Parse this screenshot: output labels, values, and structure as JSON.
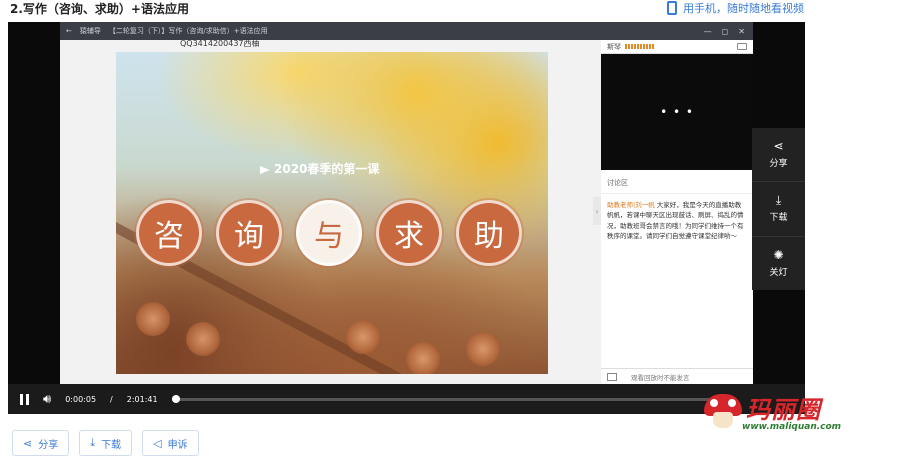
{
  "page": {
    "title": "2.写作（咨询、求助）+语法应用",
    "mobile_link": "用手机，随时随地看视频"
  },
  "app": {
    "nav_back": "←",
    "app_name": "猿辅导",
    "lesson_title": "【二轮复习（下）】写作（咨询/求助信）+语法应用",
    "minimize": "—",
    "maximize": "◻",
    "close": "✕"
  },
  "watermark": "QQ3414200437西柚",
  "slide": {
    "subtitle": "2020春季的第一课",
    "characters": [
      "咨",
      "询",
      "与",
      "求",
      "助"
    ]
  },
  "side_panel": {
    "speaker": "斯琴",
    "video_placeholder": "• • •",
    "discussion_header": "讨论区",
    "chat_author": "助教老师|刘一帆",
    "chat_text": "大家好，我是今天的直播助教帆帆，若课中聊天区出现鼓话、刷屏、捣乱的情况，助教班哥会禁言的哦！为同学们维持一个有秩序的课堂。请同学们自觉遵守课堂纪律哟～",
    "footer_notice": "观看回放时不能发言"
  },
  "side_actions": [
    {
      "icon": "share-icon",
      "glyph": "⋖",
      "label": "分享"
    },
    {
      "icon": "download-icon",
      "glyph": "⤓",
      "label": "下载"
    },
    {
      "icon": "lightbulb-icon",
      "glyph": "✺",
      "label": "关灯"
    }
  ],
  "controls": {
    "current_time": "0:00:05",
    "separator": "/",
    "duration": "2:01:41",
    "progress_fraction": 0.0007
  },
  "bottom_buttons": [
    {
      "icon": "share-icon",
      "glyph": "⋖",
      "label": "分享"
    },
    {
      "icon": "download-icon",
      "glyph": "⤓",
      "label": "下载"
    },
    {
      "icon": "report-icon",
      "glyph": "◁",
      "label": "申诉"
    }
  ],
  "logo": {
    "text": "玛丽圈",
    "url": "www.maliquan.com"
  },
  "colors": {
    "accent": "#3a7bd5",
    "slide_circle": "#c8693f",
    "logo_red": "#d6262b"
  }
}
